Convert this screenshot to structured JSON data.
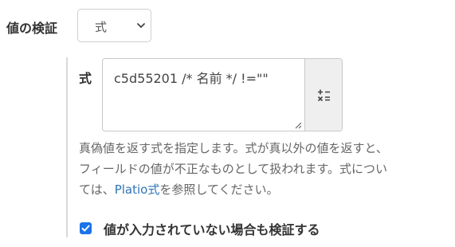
{
  "validation": {
    "label": "値の検証",
    "type_select": {
      "selected": "式"
    }
  },
  "expression": {
    "label": "式",
    "value": "c5d55201 /* 名前 */ !=\"\""
  },
  "help": {
    "line1": "真偽値を返す式を指定します。式が真以外の値を返すと、",
    "line2": "フィールドの値が不正なものとして扱われます。式につい",
    "line3_prefix": "ては、",
    "line3_link": "Platio式",
    "line3_suffix": "を参照してください。"
  },
  "validate_empty": {
    "label": "値が入力されていない場合も検証する",
    "checked": true
  },
  "colors": {
    "link": "#2e74b5",
    "checkbox": "#1a73e8"
  },
  "icons": {
    "select_chevron": "chevron-down-icon",
    "formula_button": "formula-insert-icon",
    "checkbox": "check-icon",
    "resize": "resize-grip-icon"
  }
}
